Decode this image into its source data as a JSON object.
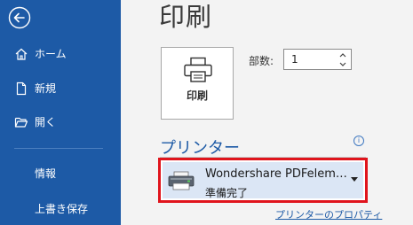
{
  "sidebar": {
    "items": [
      {
        "label": "ホーム",
        "icon": "home-icon"
      },
      {
        "label": "新規",
        "icon": "new-document-icon"
      },
      {
        "label": "開く",
        "icon": "open-folder-icon"
      },
      {
        "label": "情報"
      },
      {
        "label": "上書き保存"
      }
    ],
    "back_icon": "back-arrow-icon"
  },
  "main": {
    "title": "印刷",
    "print_button_label": "印刷",
    "copies_label": "部数:",
    "copies_value": "1",
    "printer_section_title": "プリンター",
    "printer_name": "Wondershare PDFelem…",
    "printer_status": "準備完了",
    "printer_properties_link": "プリンターのプロパティ"
  },
  "colors": {
    "sidebar_bg": "#1d5aa6",
    "accent": "#1d5aa6",
    "highlight_border": "#e0141c",
    "selected_bg": "#dbe6f5"
  }
}
